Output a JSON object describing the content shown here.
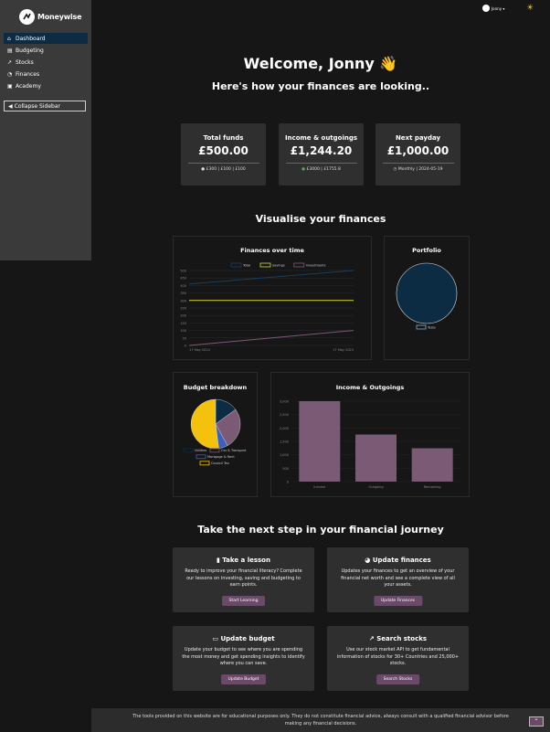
{
  "brand": {
    "name": "Moneywise"
  },
  "sidebar": {
    "items": [
      {
        "label": "Dashboard",
        "icon": "home-icon"
      },
      {
        "label": "Budgeting",
        "icon": "budget-icon"
      },
      {
        "label": "Stocks",
        "icon": "stocks-icon"
      },
      {
        "label": "Finances",
        "icon": "finances-icon"
      },
      {
        "label": "Academy",
        "icon": "academy-icon"
      }
    ],
    "collapse_label": "Collapse Sidebar"
  },
  "user": {
    "name": "Jonny ▾"
  },
  "header": {
    "welcome": "Welcome, Jonny 👋",
    "subtitle": "Here's how your finances are looking.."
  },
  "stats": [
    {
      "title": "Total funds",
      "value": "£500.00",
      "sub": "£300 | £100 | £100"
    },
    {
      "title": "Income & outgoings",
      "value": "£1,244.20",
      "sub": "£3000 | £1755.8"
    },
    {
      "title": "Next payday",
      "value": "£1,000.00",
      "sub": "Monthly | 2024-05-19"
    }
  ],
  "visualise_title": "Visualise your finances",
  "chart_data": [
    {
      "type": "line",
      "title": "Finances over time",
      "x": [
        "17 May 2024",
        "17 May 2024"
      ],
      "series": [
        {
          "name": "Total",
          "values": [
            410,
            500
          ],
          "color": "#1a3f5c"
        },
        {
          "name": "Savings",
          "values": [
            300,
            300
          ],
          "color": "#cddc39"
        },
        {
          "name": "Investments",
          "values": [
            0,
            100
          ],
          "color": "#7b5a76"
        }
      ],
      "yticks": [
        0,
        50,
        100,
        150,
        200,
        250,
        300,
        350,
        400,
        450,
        500
      ],
      "ylim": [
        0,
        500
      ]
    },
    {
      "type": "pie",
      "title": "Portfolio",
      "labels": [
        "Tesla"
      ],
      "values": [
        100
      ],
      "colors": [
        "#0b2c42"
      ]
    },
    {
      "type": "pie",
      "title": "Budget breakdown",
      "labels": [
        "Utilities",
        "Car & Transport",
        "Mortgage & Rent",
        "Council Tax"
      ],
      "values": [
        15,
        27,
        6,
        52
      ],
      "colors": [
        "#0b2c42",
        "#7b5a76",
        "#3a60c0",
        "#f4c20d"
      ]
    },
    {
      "type": "bar",
      "title": "Income & Outgoings",
      "categories": [
        "Income",
        "Outgoing",
        "Remaining"
      ],
      "values": [
        3000,
        1755.8,
        1244.2
      ],
      "yticks": [
        0,
        500,
        1000,
        1500,
        2000,
        2500,
        3000
      ],
      "ytick_labels": [
        "0",
        "500",
        "1,000",
        "1,500",
        "2,000",
        "2,500",
        "3,000"
      ],
      "ylim": [
        0,
        3000
      ],
      "color": "#7b5a76"
    }
  ],
  "next_step_title": "Take the next step in your financial journey",
  "actions": [
    {
      "title": "Take a lesson",
      "icon": "book-icon",
      "desc": "Ready to improve your financial literacy? Complete our lessons on investing, saving and budgeting to earn points.",
      "button": "Start Learning"
    },
    {
      "title": "Update finances",
      "icon": "pie-icon",
      "desc": "Updates your finances to get an overview of your financial net worth and see a complete view of all your assets.",
      "button": "Update Finances"
    },
    {
      "title": "Update budget",
      "icon": "wallet-icon",
      "desc": "Update your budget to see where you are spending the most money and get spending insights to identify where you can save.",
      "button": "Update Budget"
    },
    {
      "title": "Search stocks",
      "icon": "chart-icon",
      "desc": "Use our stock market API to get fundamental information of stocks for 30+ Countries and 25,000+ stocks.",
      "button": "Search Stocks"
    }
  ],
  "footer": {
    "text": "The tools provided on this website are for educational purposes only. They do not constitute financial advice, always consult with a qualified financial advisor before making any financial decisions."
  }
}
